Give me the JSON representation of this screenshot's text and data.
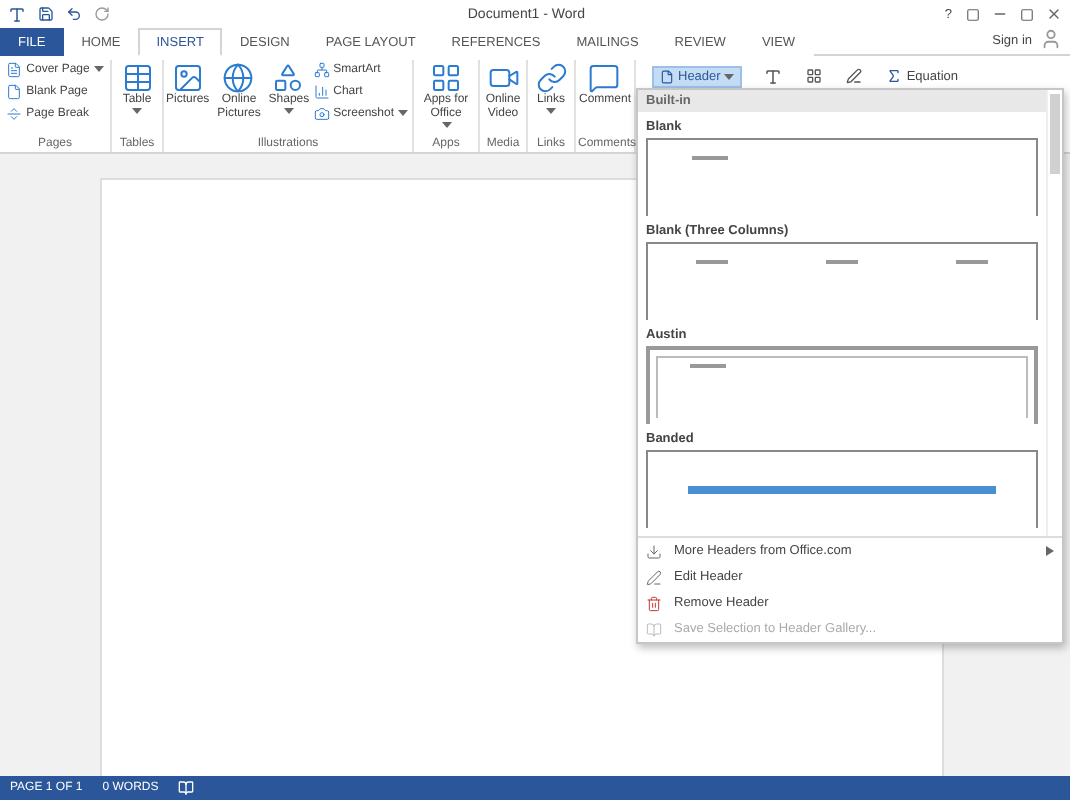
{
  "window": {
    "title": "Document1 - Word",
    "help": "?",
    "sign_in": "Sign in"
  },
  "menu_tabs": [
    {
      "label": "FILE",
      "kind": "file",
      "selected": false
    },
    {
      "label": "HOME",
      "kind": "tab",
      "selected": false
    },
    {
      "label": "INSERT",
      "kind": "tab",
      "selected": true
    },
    {
      "label": "DESIGN",
      "kind": "tab",
      "selected": false
    },
    {
      "label": "PAGE LAYOUT",
      "kind": "tab",
      "selected": false
    },
    {
      "label": "REFERENCES",
      "kind": "tab",
      "selected": false
    },
    {
      "label": "MAILINGS",
      "kind": "tab",
      "selected": false
    },
    {
      "label": "REVIEW",
      "kind": "tab",
      "selected": false
    },
    {
      "label": "VIEW",
      "kind": "tab",
      "selected": false
    }
  ],
  "ribbon": {
    "groups": [
      {
        "label": "Pages",
        "items": [
          {
            "label": "Cover Page",
            "kind": "small",
            "dropdown": true
          },
          {
            "label": "Blank Page",
            "kind": "small",
            "dropdown": false
          },
          {
            "label": "Page Break",
            "kind": "small",
            "dropdown": false
          }
        ]
      },
      {
        "label": "Tables",
        "items": [
          {
            "label": "Table",
            "kind": "large",
            "dropdown": true
          }
        ]
      },
      {
        "label": "Illustrations",
        "items": [
          {
            "label": "Pictures",
            "kind": "large",
            "dropdown": false
          },
          {
            "label": "Online Pictures",
            "kind": "large",
            "dropdown": false
          },
          {
            "label": "Shapes",
            "kind": "large",
            "dropdown": true
          },
          {
            "label": "SmartArt",
            "kind": "small",
            "dropdown": false
          },
          {
            "label": "Chart",
            "kind": "small",
            "dropdown": false
          },
          {
            "label": "Screenshot",
            "kind": "small",
            "dropdown": true
          }
        ]
      },
      {
        "label": "Apps",
        "items": [
          {
            "label": "Apps for Office",
            "kind": "large",
            "dropdown": true
          }
        ]
      },
      {
        "label": "Media",
        "items": [
          {
            "label": "Online Video",
            "kind": "large",
            "dropdown": false
          }
        ]
      },
      {
        "label": "Links",
        "items": [
          {
            "label": "Links",
            "kind": "large",
            "dropdown": true
          }
        ]
      },
      {
        "label": "Comments",
        "items": [
          {
            "label": "Comment",
            "kind": "large",
            "dropdown": false
          }
        ]
      }
    ],
    "header_button": {
      "label": "Header",
      "pressed": true
    },
    "equation": "Equation"
  },
  "header_menu": {
    "section": "Built-in",
    "gallery": [
      {
        "title": "Blank",
        "kind": "single"
      },
      {
        "title": "Blank (Three Columns)",
        "kind": "three"
      },
      {
        "title": "Austin",
        "kind": "boxed"
      },
      {
        "title": "Banded",
        "kind": "band"
      }
    ],
    "commands": [
      {
        "label": "More Headers from Office.com",
        "disabled": false,
        "submenu": true
      },
      {
        "label": "Edit Header",
        "disabled": false,
        "submenu": false
      },
      {
        "label": "Remove Header",
        "disabled": false,
        "submenu": false
      },
      {
        "label": "Save Selection to Header Gallery...",
        "disabled": true,
        "submenu": false
      }
    ]
  },
  "status_bar": {
    "page": "PAGE 1 OF 1",
    "words": "0 WORDS"
  }
}
